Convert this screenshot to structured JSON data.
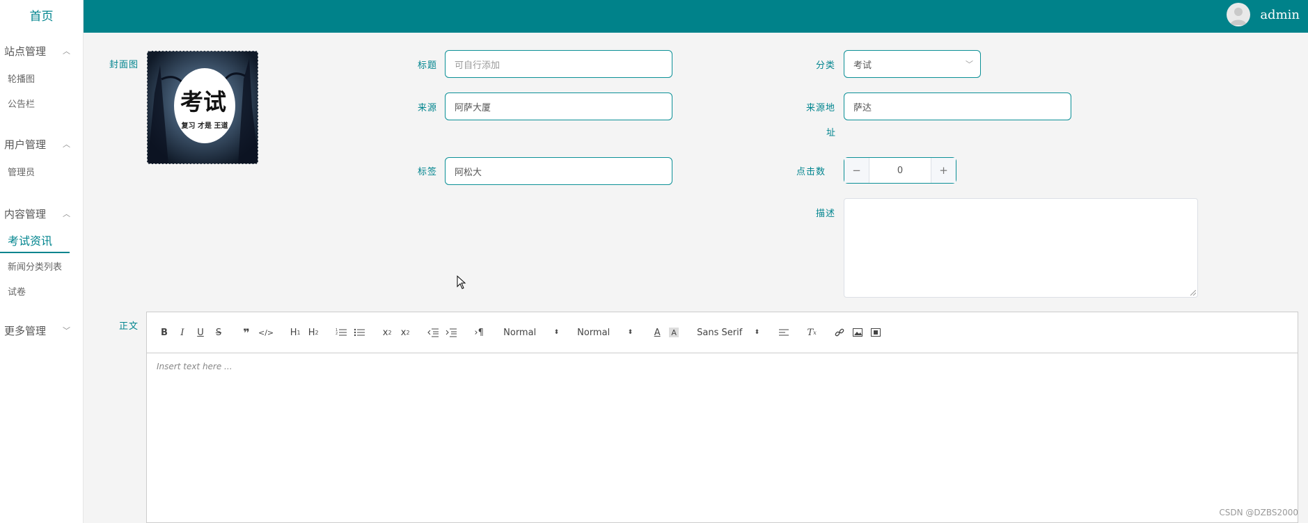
{
  "sidebar": {
    "home": "首页",
    "groups": [
      {
        "label": "站点管理",
        "items": [
          "轮播图",
          "公告栏"
        ]
      },
      {
        "label": "用户管理",
        "items": [
          "管理员"
        ]
      },
      {
        "label": "内容管理",
        "items": [
          "考试资讯",
          "新闻分类列表",
          "试卷"
        ]
      },
      {
        "label": "更多管理",
        "items": []
      }
    ],
    "active_item": "考试资讯"
  },
  "header": {
    "user": "admin"
  },
  "form": {
    "cover_label": "封面图",
    "cover_image_text": {
      "main": "考试",
      "sub": "复习 才是 王道"
    },
    "title_label": "标题",
    "title_placeholder": "可自行添加",
    "category_label": "分类",
    "category_value": "考试",
    "source_label": "来源",
    "source_value": "阿萨大厦",
    "source_addr_label_1": "来源地",
    "source_addr_label_2": "址",
    "source_addr_value": "萨达",
    "tag_label": "标签",
    "tag_value": "阿松大",
    "clicks_label": "点击数",
    "clicks_value": "0",
    "desc_label": "描述",
    "body_label": "正文"
  },
  "editor": {
    "header_picker": "Normal",
    "size_picker": "Normal",
    "font_picker": "Sans Serif",
    "placeholder": "Insert text here ..."
  },
  "watermark": "CSDN @DZBS2000",
  "colors": {
    "accent": "#00848e",
    "topbar": "#00828a"
  }
}
